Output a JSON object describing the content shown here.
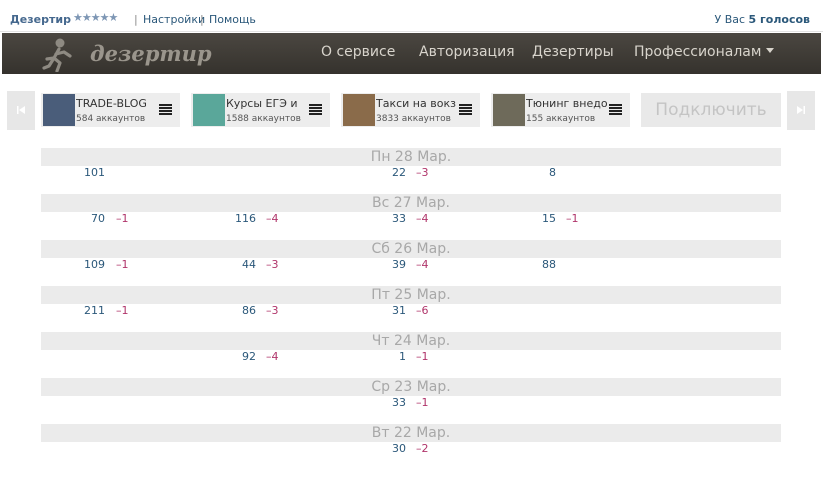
{
  "topbar": {
    "app_name": "Дезертир",
    "stars": "★★★★★",
    "settings": "Настройки",
    "help": "Помощь",
    "votes_prefix": "У Вас",
    "votes_value": "5 голосов"
  },
  "header": {
    "logo_text": "дезертир",
    "nav": [
      "О сервисе",
      "Авторизация",
      "Дезертиры",
      "Профессионалам"
    ]
  },
  "accounts": [
    {
      "name": "TRADE-BLOG",
      "count": "584 аккаунтов",
      "thumb_color": "#4a5d7a"
    },
    {
      "name": "Курсы ЕГЭ и",
      "count": "1588 аккаунтов",
      "thumb_color": "#5aa79a"
    },
    {
      "name": "Такси на вокз",
      "count": "3833 аккаунтов",
      "thumb_color": "#8a6b4a"
    },
    {
      "name": "Тюнинг внедо",
      "count": "155 аккаунтов",
      "thumb_color": "#6e6a5a"
    }
  ],
  "connect_label": "Подключить",
  "days": [
    {
      "label": "Пн 28 Мар.",
      "cols": [
        {
          "v": "101",
          "d": ""
        },
        {
          "v": "",
          "d": ""
        },
        {
          "v": "22",
          "d": "–3"
        },
        {
          "v": "8",
          "d": ""
        }
      ]
    },
    {
      "label": "Вс 27 Мар.",
      "cols": [
        {
          "v": "70",
          "d": "–1"
        },
        {
          "v": "116",
          "d": "–4"
        },
        {
          "v": "33",
          "d": "–4"
        },
        {
          "v": "15",
          "d": "–1"
        }
      ]
    },
    {
      "label": "Сб 26 Мар.",
      "cols": [
        {
          "v": "109",
          "d": "–1"
        },
        {
          "v": "44",
          "d": "–3"
        },
        {
          "v": "39",
          "d": "–4"
        },
        {
          "v": "88",
          "d": ""
        }
      ]
    },
    {
      "label": "Пт 25 Мар.",
      "cols": [
        {
          "v": "211",
          "d": "–1"
        },
        {
          "v": "86",
          "d": "–3"
        },
        {
          "v": "31",
          "d": "–6"
        },
        {
          "v": "",
          "d": ""
        }
      ]
    },
    {
      "label": "Чт 24 Мар.",
      "cols": [
        {
          "v": "",
          "d": ""
        },
        {
          "v": "92",
          "d": "–4"
        },
        {
          "v": "1",
          "d": "–1"
        },
        {
          "v": "",
          "d": ""
        }
      ]
    },
    {
      "label": "Ср 23 Мар.",
      "cols": [
        {
          "v": "",
          "d": ""
        },
        {
          "v": "",
          "d": ""
        },
        {
          "v": "33",
          "d": "–1"
        },
        {
          "v": "",
          "d": ""
        }
      ]
    },
    {
      "label": "Вт 22 Мар.",
      "cols": [
        {
          "v": "",
          "d": ""
        },
        {
          "v": "",
          "d": ""
        },
        {
          "v": "30",
          "d": "–2"
        },
        {
          "v": "",
          "d": ""
        }
      ]
    }
  ]
}
